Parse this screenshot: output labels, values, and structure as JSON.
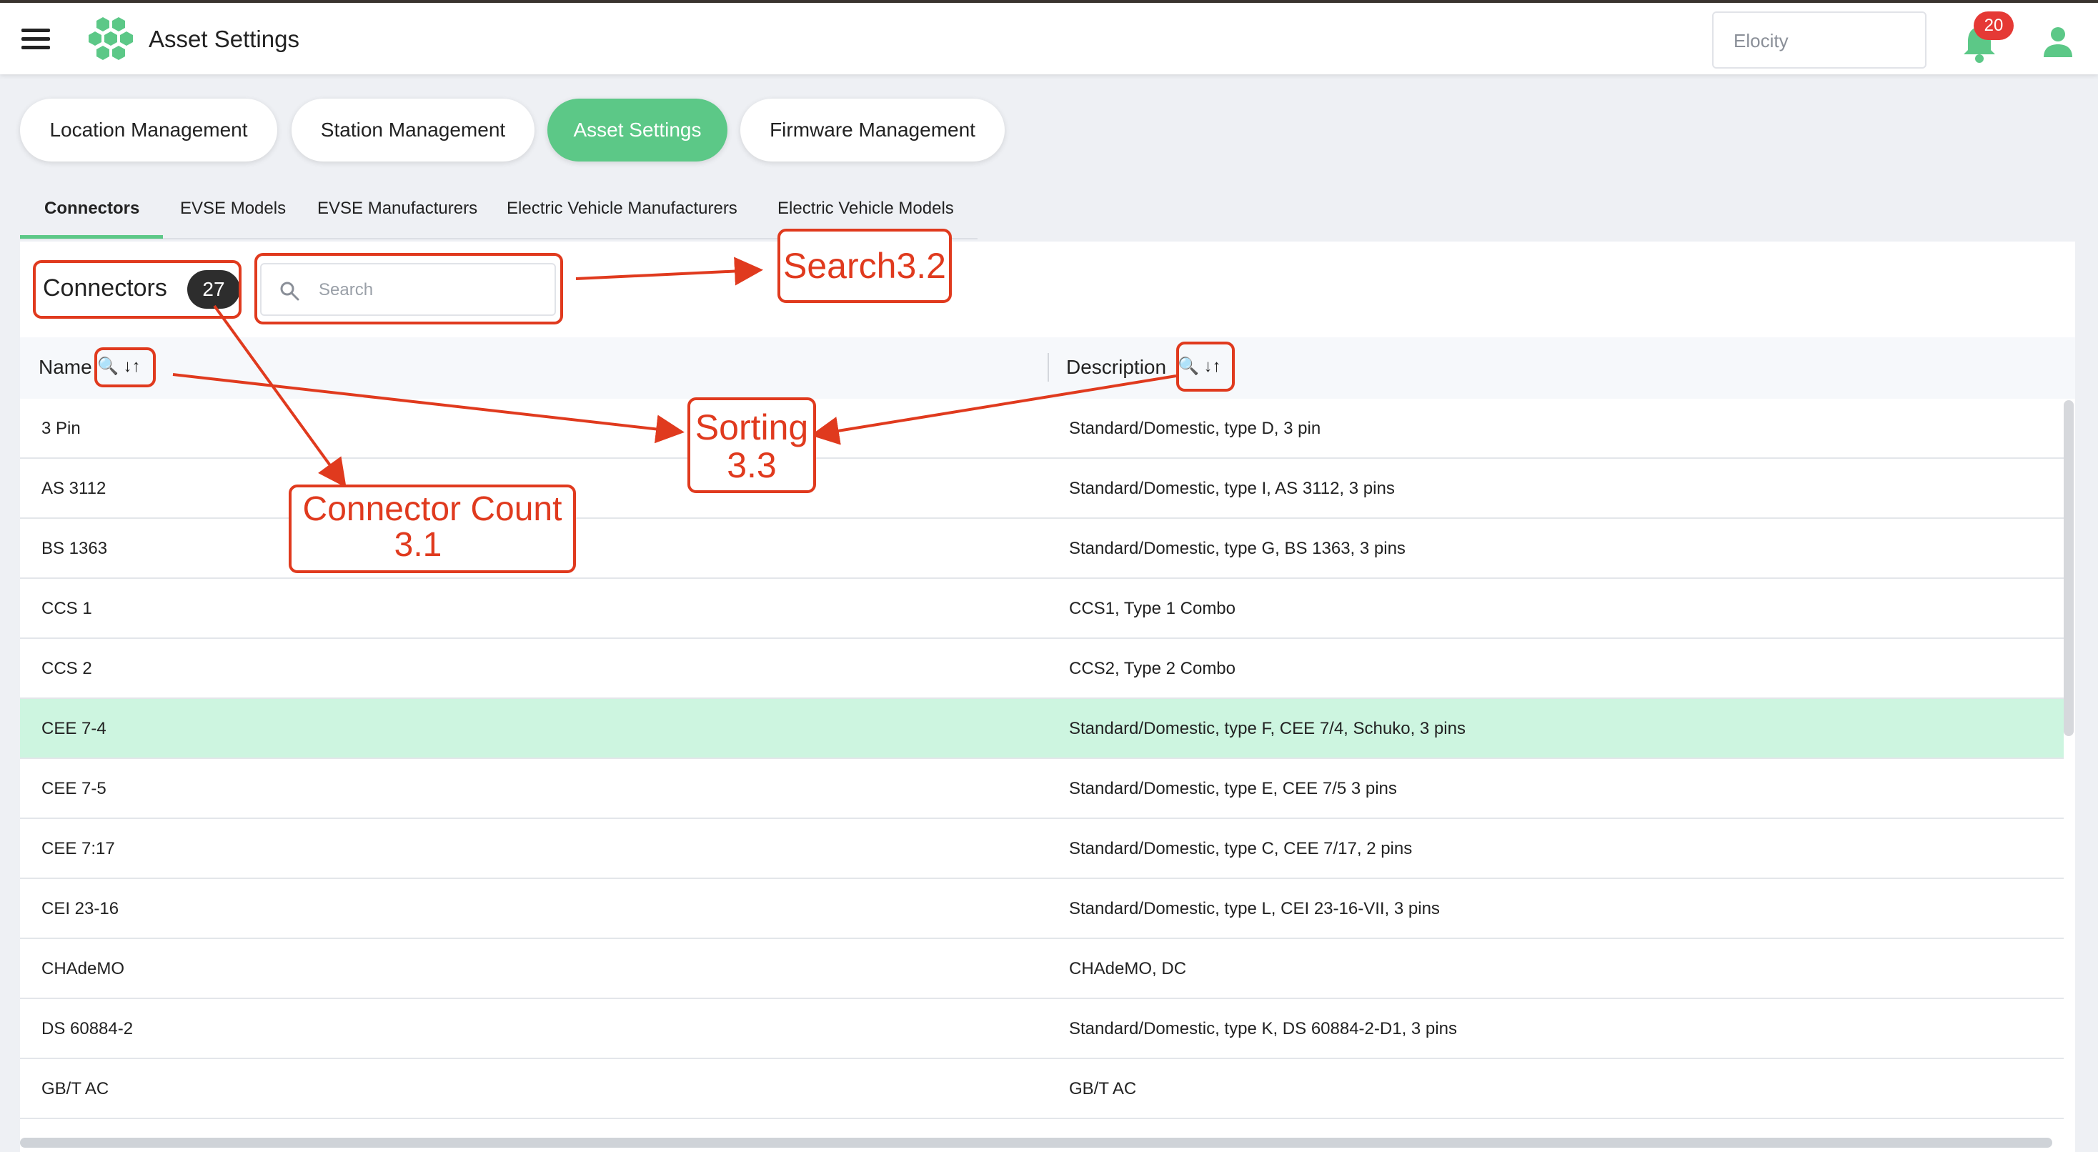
{
  "app": {
    "title": "Asset Settings",
    "tenant": "Elocity",
    "notification_count": "20"
  },
  "main_tabs": [
    {
      "label": "Location Management"
    },
    {
      "label": "Station Management"
    },
    {
      "label": "Asset Settings",
      "active": true
    },
    {
      "label": "Firmware Management"
    }
  ],
  "sub_tabs": [
    {
      "label": "Connectors",
      "active": true
    },
    {
      "label": "EVSE Models"
    },
    {
      "label": "EVSE Manufacturers"
    },
    {
      "label": "Electric Vehicle Manufacturers"
    },
    {
      "label": "Electric Vehicle Models"
    }
  ],
  "section": {
    "title": "Connectors",
    "count": "27"
  },
  "search": {
    "placeholder": "Search"
  },
  "table": {
    "columns": [
      {
        "label": "Name",
        "icons": "🔍 ↓↑"
      },
      {
        "label": "Description",
        "icons": "🔍 ↓↑"
      }
    ],
    "rows": [
      {
        "name": "3 Pin",
        "description": "Standard/Domestic, type D, 3 pin"
      },
      {
        "name": "AS 3112",
        "description": "Standard/Domestic, type I, AS 3112, 3 pins"
      },
      {
        "name": "BS 1363",
        "description": "Standard/Domestic, type G, BS 1363, 3 pins"
      },
      {
        "name": "CCS 1",
        "description": "CCS1, Type 1 Combo"
      },
      {
        "name": "CCS 2",
        "description": "CCS2, Type 2 Combo"
      },
      {
        "name": "CEE 7-4",
        "description": "Standard/Domestic, type F, CEE 7/4, Schuko, 3 pins",
        "highlighted": true
      },
      {
        "name": "CEE 7-5",
        "description": "Standard/Domestic, type E, CEE 7/5 3 pins"
      },
      {
        "name": "CEE 7:17",
        "description": "Standard/Domestic, type C, CEE 7/17, 2 pins"
      },
      {
        "name": "CEI 23-16",
        "description": "Standard/Domestic, type L, CEI 23-16-VII, 3 pins"
      },
      {
        "name": "CHAdeMO",
        "description": "CHAdeMO, DC"
      },
      {
        "name": "DS 60884-2",
        "description": "Standard/Domestic, type K, DS 60884-2-D1, 3 pins"
      },
      {
        "name": "GB/T AC",
        "description": "GB/T AC"
      }
    ]
  },
  "annotations": {
    "search": {
      "text": "Search",
      "num": "3.2"
    },
    "sorting": {
      "line1": "Sorting",
      "line2": "3.3"
    },
    "count": {
      "line1": "Connector Count",
      "line2": "3.1"
    }
  },
  "colors": {
    "accent": "#5cc887",
    "row_highlight": "#cdf5e0",
    "annotation": "#e03a1e",
    "notification": "#e53935"
  },
  "icons": [
    "menu-icon",
    "logo-icon",
    "bell-icon",
    "user-icon",
    "search-icon",
    "magnifier-icon",
    "sort-icon"
  ]
}
